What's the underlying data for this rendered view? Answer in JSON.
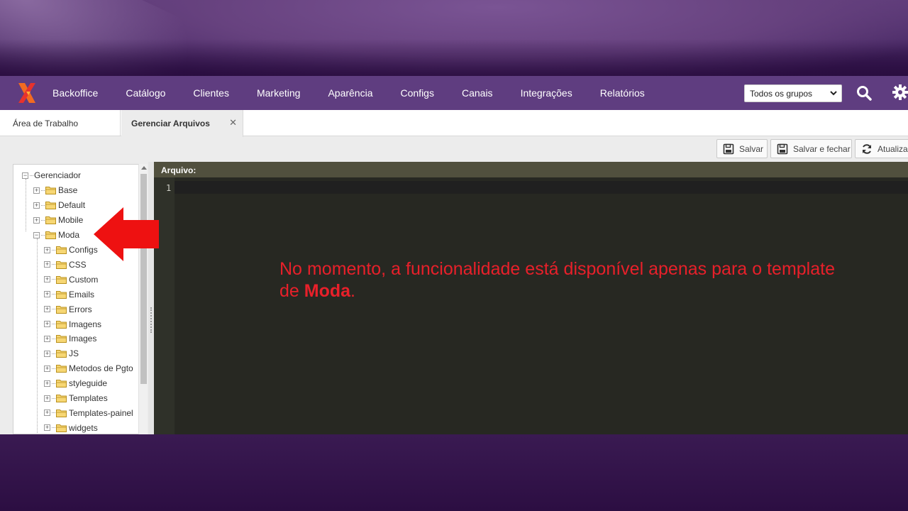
{
  "topnav": {
    "menu": [
      "Backoffice",
      "Catálogo",
      "Clientes",
      "Marketing",
      "Aparência",
      "Configs",
      "Canais",
      "Integrações",
      "Relatórios"
    ],
    "group_select": "Todos os grupos",
    "icons": [
      "logo-icon",
      "search-icon",
      "gear-icon",
      "chevron-down-icon"
    ]
  },
  "tabs": {
    "tab1": "Área de Trabalho",
    "tab2": "Gerenciar Arquivos",
    "close": "✕"
  },
  "toolbar": {
    "save": "Salvar",
    "save_close": "Salvar e fechar",
    "refresh": "Atualizar"
  },
  "tree": {
    "root": "Gerenciador",
    "level1": [
      "Base",
      "Default",
      "Mobile",
      "Moda"
    ],
    "moda_children": [
      "Configs",
      "CSS",
      "Custom",
      "Emails",
      "Errors",
      "Imagens",
      "Images",
      "JS",
      "Metodos de Pgto",
      "styleguide",
      "Templates",
      "Templates-painel",
      "widgets"
    ]
  },
  "editor": {
    "header": "Arquivo:",
    "line_number": "1"
  },
  "annotation": {
    "text_before": "No momento, a funcionalidade está disponível apenas para o template de ",
    "text_bold": "Moda",
    "text_after": ".",
    "color": "#e8202a"
  },
  "colors": {
    "nav": "#5f3d80",
    "editor_bg": "#272822",
    "editor_header": "#51503e"
  }
}
